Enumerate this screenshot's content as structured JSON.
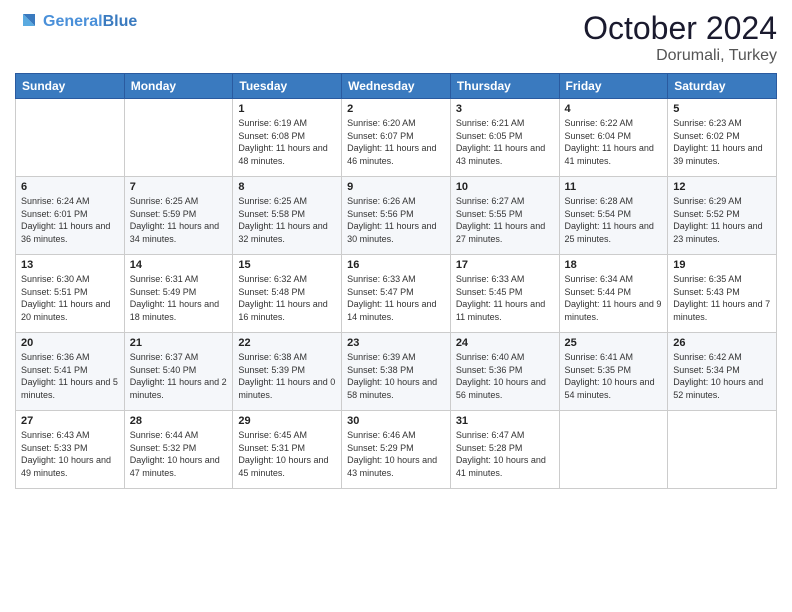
{
  "header": {
    "logo_line1": "General",
    "logo_line2": "Blue",
    "month_year": "October 2024",
    "location": "Dorumali, Turkey"
  },
  "weekdays": [
    "Sunday",
    "Monday",
    "Tuesday",
    "Wednesday",
    "Thursday",
    "Friday",
    "Saturday"
  ],
  "weeks": [
    [
      {
        "day": "",
        "sunrise": "",
        "sunset": "",
        "daylight": ""
      },
      {
        "day": "",
        "sunrise": "",
        "sunset": "",
        "daylight": ""
      },
      {
        "day": "1",
        "sunrise": "Sunrise: 6:19 AM",
        "sunset": "Sunset: 6:08 PM",
        "daylight": "Daylight: 11 hours and 48 minutes."
      },
      {
        "day": "2",
        "sunrise": "Sunrise: 6:20 AM",
        "sunset": "Sunset: 6:07 PM",
        "daylight": "Daylight: 11 hours and 46 minutes."
      },
      {
        "day": "3",
        "sunrise": "Sunrise: 6:21 AM",
        "sunset": "Sunset: 6:05 PM",
        "daylight": "Daylight: 11 hours and 43 minutes."
      },
      {
        "day": "4",
        "sunrise": "Sunrise: 6:22 AM",
        "sunset": "Sunset: 6:04 PM",
        "daylight": "Daylight: 11 hours and 41 minutes."
      },
      {
        "day": "5",
        "sunrise": "Sunrise: 6:23 AM",
        "sunset": "Sunset: 6:02 PM",
        "daylight": "Daylight: 11 hours and 39 minutes."
      }
    ],
    [
      {
        "day": "6",
        "sunrise": "Sunrise: 6:24 AM",
        "sunset": "Sunset: 6:01 PM",
        "daylight": "Daylight: 11 hours and 36 minutes."
      },
      {
        "day": "7",
        "sunrise": "Sunrise: 6:25 AM",
        "sunset": "Sunset: 5:59 PM",
        "daylight": "Daylight: 11 hours and 34 minutes."
      },
      {
        "day": "8",
        "sunrise": "Sunrise: 6:25 AM",
        "sunset": "Sunset: 5:58 PM",
        "daylight": "Daylight: 11 hours and 32 minutes."
      },
      {
        "day": "9",
        "sunrise": "Sunrise: 6:26 AM",
        "sunset": "Sunset: 5:56 PM",
        "daylight": "Daylight: 11 hours and 30 minutes."
      },
      {
        "day": "10",
        "sunrise": "Sunrise: 6:27 AM",
        "sunset": "Sunset: 5:55 PM",
        "daylight": "Daylight: 11 hours and 27 minutes."
      },
      {
        "day": "11",
        "sunrise": "Sunrise: 6:28 AM",
        "sunset": "Sunset: 5:54 PM",
        "daylight": "Daylight: 11 hours and 25 minutes."
      },
      {
        "day": "12",
        "sunrise": "Sunrise: 6:29 AM",
        "sunset": "Sunset: 5:52 PM",
        "daylight": "Daylight: 11 hours and 23 minutes."
      }
    ],
    [
      {
        "day": "13",
        "sunrise": "Sunrise: 6:30 AM",
        "sunset": "Sunset: 5:51 PM",
        "daylight": "Daylight: 11 hours and 20 minutes."
      },
      {
        "day": "14",
        "sunrise": "Sunrise: 6:31 AM",
        "sunset": "Sunset: 5:49 PM",
        "daylight": "Daylight: 11 hours and 18 minutes."
      },
      {
        "day": "15",
        "sunrise": "Sunrise: 6:32 AM",
        "sunset": "Sunset: 5:48 PM",
        "daylight": "Daylight: 11 hours and 16 minutes."
      },
      {
        "day": "16",
        "sunrise": "Sunrise: 6:33 AM",
        "sunset": "Sunset: 5:47 PM",
        "daylight": "Daylight: 11 hours and 14 minutes."
      },
      {
        "day": "17",
        "sunrise": "Sunrise: 6:33 AM",
        "sunset": "Sunset: 5:45 PM",
        "daylight": "Daylight: 11 hours and 11 minutes."
      },
      {
        "day": "18",
        "sunrise": "Sunrise: 6:34 AM",
        "sunset": "Sunset: 5:44 PM",
        "daylight": "Daylight: 11 hours and 9 minutes."
      },
      {
        "day": "19",
        "sunrise": "Sunrise: 6:35 AM",
        "sunset": "Sunset: 5:43 PM",
        "daylight": "Daylight: 11 hours and 7 minutes."
      }
    ],
    [
      {
        "day": "20",
        "sunrise": "Sunrise: 6:36 AM",
        "sunset": "Sunset: 5:41 PM",
        "daylight": "Daylight: 11 hours and 5 minutes."
      },
      {
        "day": "21",
        "sunrise": "Sunrise: 6:37 AM",
        "sunset": "Sunset: 5:40 PM",
        "daylight": "Daylight: 11 hours and 2 minutes."
      },
      {
        "day": "22",
        "sunrise": "Sunrise: 6:38 AM",
        "sunset": "Sunset: 5:39 PM",
        "daylight": "Daylight: 11 hours and 0 minutes."
      },
      {
        "day": "23",
        "sunrise": "Sunrise: 6:39 AM",
        "sunset": "Sunset: 5:38 PM",
        "daylight": "Daylight: 10 hours and 58 minutes."
      },
      {
        "day": "24",
        "sunrise": "Sunrise: 6:40 AM",
        "sunset": "Sunset: 5:36 PM",
        "daylight": "Daylight: 10 hours and 56 minutes."
      },
      {
        "day": "25",
        "sunrise": "Sunrise: 6:41 AM",
        "sunset": "Sunset: 5:35 PM",
        "daylight": "Daylight: 10 hours and 54 minutes."
      },
      {
        "day": "26",
        "sunrise": "Sunrise: 6:42 AM",
        "sunset": "Sunset: 5:34 PM",
        "daylight": "Daylight: 10 hours and 52 minutes."
      }
    ],
    [
      {
        "day": "27",
        "sunrise": "Sunrise: 6:43 AM",
        "sunset": "Sunset: 5:33 PM",
        "daylight": "Daylight: 10 hours and 49 minutes."
      },
      {
        "day": "28",
        "sunrise": "Sunrise: 6:44 AM",
        "sunset": "Sunset: 5:32 PM",
        "daylight": "Daylight: 10 hours and 47 minutes."
      },
      {
        "day": "29",
        "sunrise": "Sunrise: 6:45 AM",
        "sunset": "Sunset: 5:31 PM",
        "daylight": "Daylight: 10 hours and 45 minutes."
      },
      {
        "day": "30",
        "sunrise": "Sunrise: 6:46 AM",
        "sunset": "Sunset: 5:29 PM",
        "daylight": "Daylight: 10 hours and 43 minutes."
      },
      {
        "day": "31",
        "sunrise": "Sunrise: 6:47 AM",
        "sunset": "Sunset: 5:28 PM",
        "daylight": "Daylight: 10 hours and 41 minutes."
      },
      {
        "day": "",
        "sunrise": "",
        "sunset": "",
        "daylight": ""
      },
      {
        "day": "",
        "sunrise": "",
        "sunset": "",
        "daylight": ""
      }
    ]
  ]
}
